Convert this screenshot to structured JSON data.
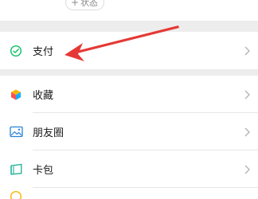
{
  "header": {
    "status_plus": "+",
    "status_label": "状态"
  },
  "menu": {
    "pay": {
      "label": "支付",
      "icon": "wechat-pay-icon"
    },
    "favorites": {
      "label": "收藏",
      "icon": "favorites-cube-icon"
    },
    "moments": {
      "label": "朋友圈",
      "icon": "moments-photo-icon"
    },
    "cards": {
      "label": "卡包",
      "icon": "card-wallet-icon"
    }
  },
  "annotation": {
    "arrow_color": "#e53935",
    "target": "pay"
  },
  "colors": {
    "background": "#ededed",
    "row_background": "#ffffff",
    "text": "#1a1a1a",
    "chevron": "#b2b2b2",
    "pay_icon": "#07c160"
  }
}
